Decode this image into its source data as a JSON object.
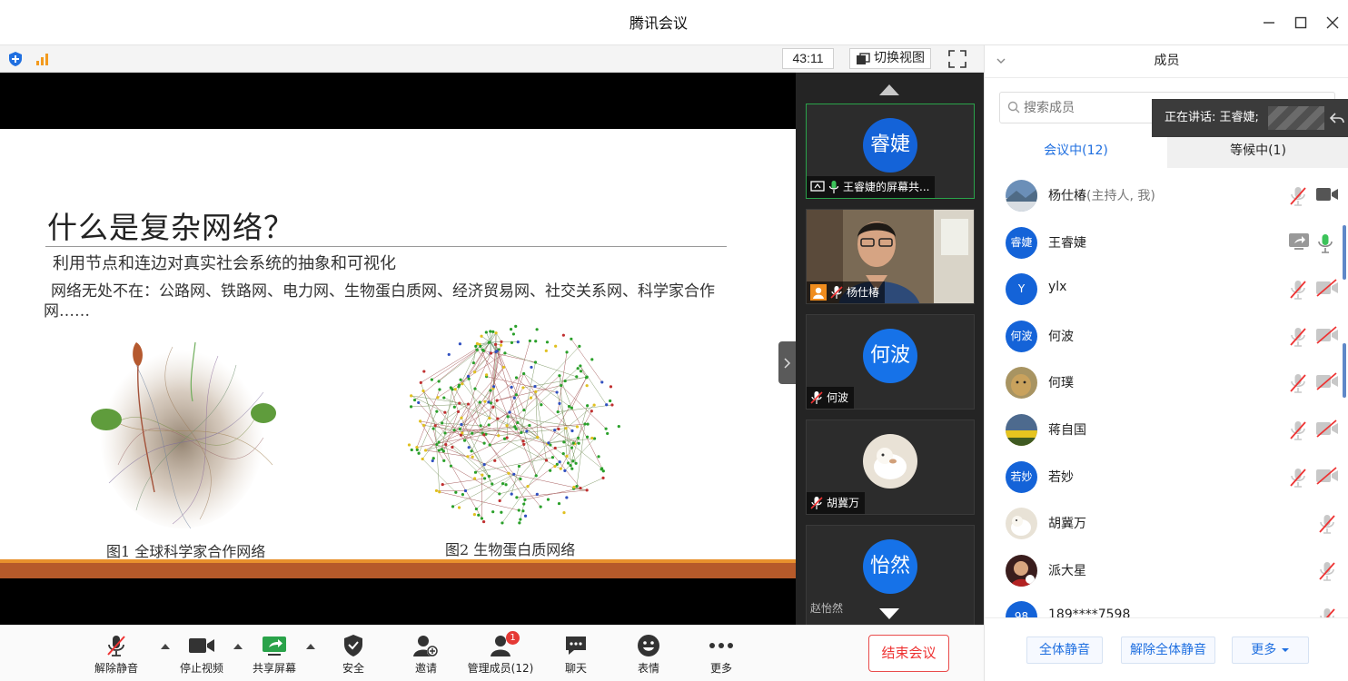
{
  "window": {
    "title": "腾讯会议"
  },
  "video_toolbar": {
    "timer": "43:11",
    "switch_view": "切换视图"
  },
  "slide": {
    "title": "什么是复杂网络？",
    "subtitle": "利用节点和连边对真实社会系统的抽象和可视化",
    "body": "网络无处不在：公路网、铁路网、电力网、生物蛋白质网、经济贸易网、社交关系网、科学家合作网……",
    "fig1_caption": "图1 全球科学家合作网络",
    "fig2_caption": "图2 生物蛋白质网络"
  },
  "thumbnails": [
    {
      "avatar": "睿婕",
      "label": "王睿婕的屏幕共..."
    },
    {
      "avatar": "",
      "label": "杨仕椿"
    },
    {
      "avatar": "何波",
      "label": "何波"
    },
    {
      "avatar": "",
      "label": "胡冀万"
    },
    {
      "avatar": "怡然",
      "label": "赵怡然"
    }
  ],
  "bottom_toolbar": {
    "unmute": "解除静音",
    "stop_video": "停止视频",
    "share_screen": "共享屏幕",
    "security": "安全",
    "invite": "邀请",
    "manage_members": "管理成员(12)",
    "manage_badge": "1",
    "chat": "聊天",
    "emoji": "表情",
    "more": "更多",
    "end_meeting": "结束会议"
  },
  "panel": {
    "title": "成员",
    "search_placeholder": "搜索成员",
    "speaking": "正在讲话: 王睿婕;",
    "tab_in_meeting": "会议中(12)",
    "tab_waiting": "等候中(1)",
    "members": [
      {
        "avatar": "",
        "name": "杨仕椿",
        "tag": "(主持人, 我)"
      },
      {
        "avatar": "睿婕",
        "name": "王睿婕",
        "tag": ""
      },
      {
        "avatar": "Y",
        "name": "ylx",
        "tag": ""
      },
      {
        "avatar": "何波",
        "name": "何波",
        "tag": ""
      },
      {
        "avatar": "",
        "name": "何璞",
        "tag": ""
      },
      {
        "avatar": "",
        "name": "蒋自国",
        "tag": ""
      },
      {
        "avatar": "若妙",
        "name": "若妙",
        "tag": ""
      },
      {
        "avatar": "",
        "name": "胡冀万",
        "tag": ""
      },
      {
        "avatar": "",
        "name": "派大星",
        "tag": ""
      },
      {
        "avatar": "98",
        "name": "189****7598",
        "tag": ""
      }
    ],
    "mute_all": "全体静音",
    "unmute_all": "解除全体静音",
    "more": "更多"
  },
  "colors": {
    "accent": "#1f6fe0",
    "avatar_blue": "#1463d8",
    "end_red": "#e33333",
    "slide_bar": "#b65a2a"
  }
}
